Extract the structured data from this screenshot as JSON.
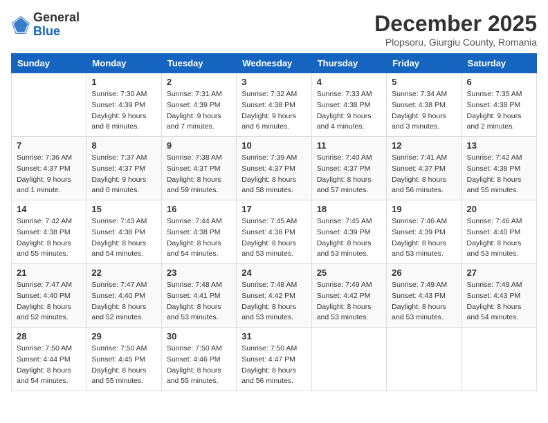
{
  "header": {
    "logo_general": "General",
    "logo_blue": "Blue",
    "month_year": "December 2025",
    "location": "Plopsoru, Giurgiu County, Romania"
  },
  "weekdays": [
    "Sunday",
    "Monday",
    "Tuesday",
    "Wednesday",
    "Thursday",
    "Friday",
    "Saturday"
  ],
  "weeks": [
    [
      {
        "day": "",
        "sunrise": "",
        "sunset": "",
        "daylight": ""
      },
      {
        "day": "1",
        "sunrise": "7:30 AM",
        "sunset": "4:39 PM",
        "daylight": "9 hours and 8 minutes."
      },
      {
        "day": "2",
        "sunrise": "7:31 AM",
        "sunset": "4:39 PM",
        "daylight": "9 hours and 7 minutes."
      },
      {
        "day": "3",
        "sunrise": "7:32 AM",
        "sunset": "4:38 PM",
        "daylight": "9 hours and 6 minutes."
      },
      {
        "day": "4",
        "sunrise": "7:33 AM",
        "sunset": "4:38 PM",
        "daylight": "9 hours and 4 minutes."
      },
      {
        "day": "5",
        "sunrise": "7:34 AM",
        "sunset": "4:38 PM",
        "daylight": "9 hours and 3 minutes."
      },
      {
        "day": "6",
        "sunrise": "7:35 AM",
        "sunset": "4:38 PM",
        "daylight": "9 hours and 2 minutes."
      }
    ],
    [
      {
        "day": "7",
        "sunrise": "7:36 AM",
        "sunset": "4:37 PM",
        "daylight": "9 hours and 1 minute."
      },
      {
        "day": "8",
        "sunrise": "7:37 AM",
        "sunset": "4:37 PM",
        "daylight": "9 hours and 0 minutes."
      },
      {
        "day": "9",
        "sunrise": "7:38 AM",
        "sunset": "4:37 PM",
        "daylight": "8 hours and 59 minutes."
      },
      {
        "day": "10",
        "sunrise": "7:39 AM",
        "sunset": "4:37 PM",
        "daylight": "8 hours and 58 minutes."
      },
      {
        "day": "11",
        "sunrise": "7:40 AM",
        "sunset": "4:37 PM",
        "daylight": "8 hours and 57 minutes."
      },
      {
        "day": "12",
        "sunrise": "7:41 AM",
        "sunset": "4:37 PM",
        "daylight": "8 hours and 56 minutes."
      },
      {
        "day": "13",
        "sunrise": "7:42 AM",
        "sunset": "4:38 PM",
        "daylight": "8 hours and 55 minutes."
      }
    ],
    [
      {
        "day": "14",
        "sunrise": "7:42 AM",
        "sunset": "4:38 PM",
        "daylight": "8 hours and 55 minutes."
      },
      {
        "day": "15",
        "sunrise": "7:43 AM",
        "sunset": "4:38 PM",
        "daylight": "8 hours and 54 minutes."
      },
      {
        "day": "16",
        "sunrise": "7:44 AM",
        "sunset": "4:38 PM",
        "daylight": "8 hours and 54 minutes."
      },
      {
        "day": "17",
        "sunrise": "7:45 AM",
        "sunset": "4:38 PM",
        "daylight": "8 hours and 53 minutes."
      },
      {
        "day": "18",
        "sunrise": "7:45 AM",
        "sunset": "4:39 PM",
        "daylight": "8 hours and 53 minutes."
      },
      {
        "day": "19",
        "sunrise": "7:46 AM",
        "sunset": "4:39 PM",
        "daylight": "8 hours and 53 minutes."
      },
      {
        "day": "20",
        "sunrise": "7:46 AM",
        "sunset": "4:40 PM",
        "daylight": "8 hours and 53 minutes."
      }
    ],
    [
      {
        "day": "21",
        "sunrise": "7:47 AM",
        "sunset": "4:40 PM",
        "daylight": "8 hours and 52 minutes."
      },
      {
        "day": "22",
        "sunrise": "7:47 AM",
        "sunset": "4:40 PM",
        "daylight": "8 hours and 52 minutes."
      },
      {
        "day": "23",
        "sunrise": "7:48 AM",
        "sunset": "4:41 PM",
        "daylight": "8 hours and 53 minutes."
      },
      {
        "day": "24",
        "sunrise": "7:48 AM",
        "sunset": "4:42 PM",
        "daylight": "8 hours and 53 minutes."
      },
      {
        "day": "25",
        "sunrise": "7:49 AM",
        "sunset": "4:42 PM",
        "daylight": "8 hours and 53 minutes."
      },
      {
        "day": "26",
        "sunrise": "7:49 AM",
        "sunset": "4:43 PM",
        "daylight": "8 hours and 53 minutes."
      },
      {
        "day": "27",
        "sunrise": "7:49 AM",
        "sunset": "4:43 PM",
        "daylight": "8 hours and 54 minutes."
      }
    ],
    [
      {
        "day": "28",
        "sunrise": "7:50 AM",
        "sunset": "4:44 PM",
        "daylight": "8 hours and 54 minutes."
      },
      {
        "day": "29",
        "sunrise": "7:50 AM",
        "sunset": "4:45 PM",
        "daylight": "8 hours and 55 minutes."
      },
      {
        "day": "30",
        "sunrise": "7:50 AM",
        "sunset": "4:46 PM",
        "daylight": "8 hours and 55 minutes."
      },
      {
        "day": "31",
        "sunrise": "7:50 AM",
        "sunset": "4:47 PM",
        "daylight": "8 hours and 56 minutes."
      },
      {
        "day": "",
        "sunrise": "",
        "sunset": "",
        "daylight": ""
      },
      {
        "day": "",
        "sunrise": "",
        "sunset": "",
        "daylight": ""
      },
      {
        "day": "",
        "sunrise": "",
        "sunset": "",
        "daylight": ""
      }
    ]
  ]
}
